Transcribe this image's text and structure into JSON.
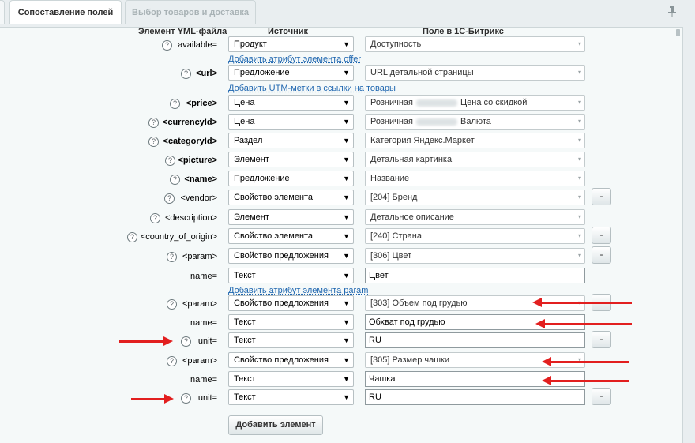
{
  "tabs": [
    {
      "label": "Сопоставление полей"
    },
    {
      "label": "Выбор товаров и доставка"
    }
  ],
  "headers": {
    "element": "Элемент YML-файла",
    "source": "Источник",
    "field": "Поле в 1С-Битрикс"
  },
  "help_glyph": "?",
  "select_arrow": "▼",
  "field_arrow": "▾",
  "minus_label": "-",
  "pin_icon": "pin-icon",
  "rows": [
    {
      "label": "available=",
      "bold": false,
      "source": "Продукт",
      "field": "Доступность",
      "minus": false
    },
    {
      "label": "<url>",
      "bold": true,
      "source": "Предложение",
      "field": "URL детальной страницы",
      "minus": false
    },
    {
      "label": "<price>",
      "bold": true,
      "source": "Цена",
      "field_pre": "Розничная",
      "field": "Цена со скидкой",
      "minus": false
    },
    {
      "label": "<currencyId>",
      "bold": true,
      "source": "Цена",
      "field_pre": "Розничная",
      "field": "Валюта",
      "minus": false
    },
    {
      "label": "<categoryId>",
      "bold": true,
      "source": "Раздел",
      "field": "Категория Яндекс.Маркет",
      "minus": false
    },
    {
      "label": "<picture>",
      "bold": true,
      "source": "Элемент",
      "field": "Детальная картинка",
      "minus": false
    },
    {
      "label": "<name>",
      "bold": true,
      "source": "Предложение",
      "field": "Название",
      "minus": false
    },
    {
      "label": "<vendor>",
      "bold": false,
      "source": "Свойство элемента",
      "field": "[204] Бренд",
      "minus": true
    },
    {
      "label": "<description>",
      "bold": false,
      "source": "Элемент",
      "field": "Детальное описание",
      "minus": false
    },
    {
      "label": "<country_of_origin>",
      "bold": false,
      "source": "Свойство элемента",
      "field": "[240] Страна",
      "minus": true
    },
    {
      "label": "<param>",
      "bold": false,
      "source": "Свойство предложения",
      "field": "[306] Цвет",
      "minus": true
    },
    {
      "label": "name=",
      "bold": false,
      "source": "Текст",
      "value": "Цвет",
      "minus": false
    },
    {
      "label": "<param>",
      "bold": false,
      "source": "Свойство предложения",
      "field": "[303] Объем под грудью",
      "minus": true
    },
    {
      "label": "name=",
      "bold": false,
      "source": "Текст",
      "value": "Обхват под грудью",
      "minus": false
    },
    {
      "label": "unit=",
      "bold": false,
      "source": "Текст",
      "value": "RU",
      "minus": true
    },
    {
      "label": "<param>",
      "bold": false,
      "source": "Свойство предложения",
      "field": "[305] Размер чашки",
      "minus": false
    },
    {
      "label": "name=",
      "bold": false,
      "source": "Текст",
      "value": "Чашка",
      "minus": false
    },
    {
      "label": "unit=",
      "bold": false,
      "source": "Текст",
      "value": "RU",
      "minus": true
    }
  ],
  "links": {
    "add_offer_attr": "Добавить атрибут элемента offer",
    "add_utm": "Добавить UTM-метки в ссылки на товары",
    "add_param_attr": "Добавить атрибут элемента param"
  },
  "add_element_button": "Добавить элемент",
  "annotation_color": "#e21f1f"
}
